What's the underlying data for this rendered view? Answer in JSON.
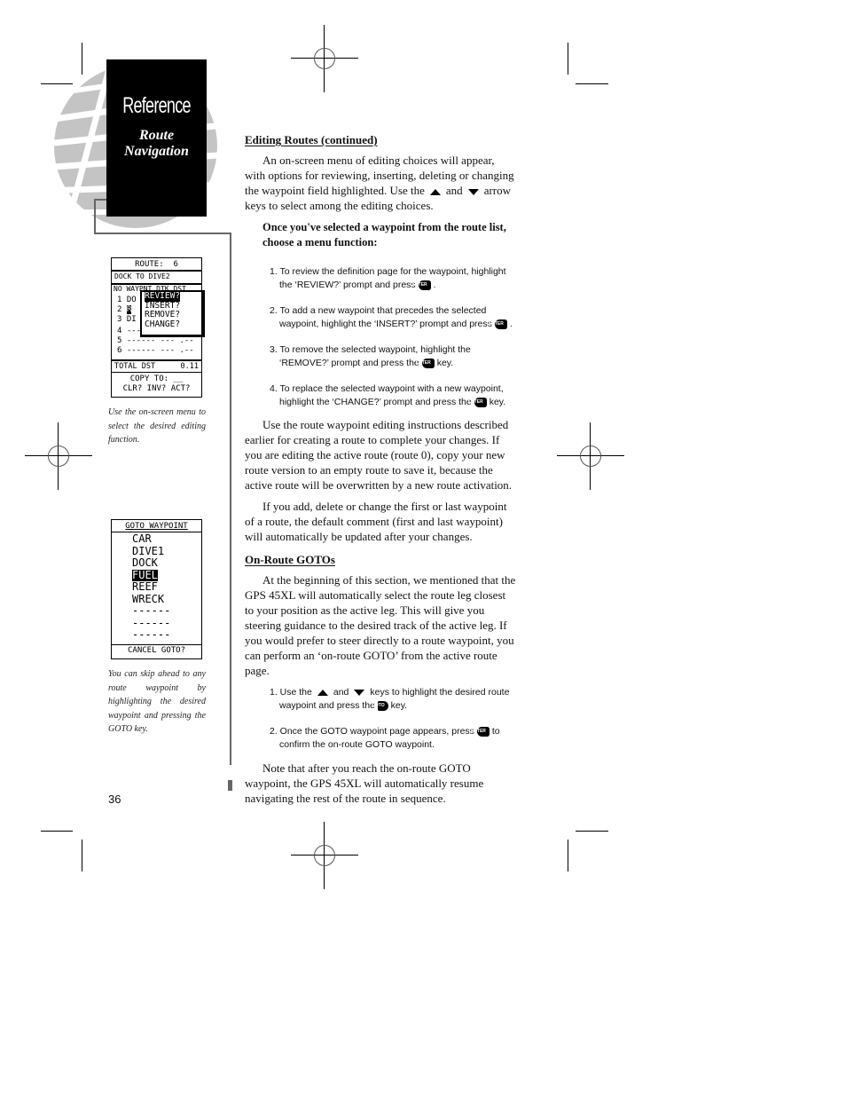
{
  "sidebar": {
    "section_title": "Reference",
    "section_subtitle_line1": "Route",
    "section_subtitle_line2": "Navigation"
  },
  "figure1": {
    "title": "ROUTE:  6",
    "comment": "DOCK TO DIVE2",
    "header": "NO WAYPNT DTK DST",
    "rows": [
      {
        "no": "1",
        "wpt": "DO"
      },
      {
        "no": "2",
        "wpt": "R"
      },
      {
        "no": "3",
        "wpt": "DI"
      },
      {
        "no": "4",
        "wpt": "------",
        "dtk": "",
        "dst": "."
      },
      {
        "no": "5",
        "wpt": "------",
        "dtk": "---",
        "dst": ".--"
      },
      {
        "no": "6",
        "wpt": "------",
        "dtk": "---",
        "dst": ".--"
      }
    ],
    "menu": [
      "REVIEW?",
      "INSERT?",
      "REMOVE?",
      "CHANGE?"
    ],
    "menu_selected": "REVIEW?",
    "total_label": "TOTAL DST",
    "total_value": "0.11",
    "copy_to": "COPY TO: __",
    "actions": "CLR? INV? ACT?",
    "caption": "Use the on-screen menu to select the desired editing function."
  },
  "figure2": {
    "title": "GOTO WAYPOINT",
    "waypoints": [
      "CAR",
      "DIVE1",
      "DOCK",
      "FUEL",
      "REEF",
      "WRECK",
      "------",
      "------",
      "------"
    ],
    "selected": "FUEL",
    "footer": "CANCEL GOTO?",
    "caption": "You can skip ahead to any route waypoint by highlighting the desired waypoint and pressing the GOTO key."
  },
  "content": {
    "heading1": "Editing Routes (continued)",
    "para1_a": "An on-screen menu of editing choices will appear, with options for reviewing, inserting, deleting or changing the waypoint field highlighted. Use the",
    "para1_b": "and",
    "para1_c": "arrow keys to select among the editing choices.",
    "bold_instruction": "Once you've selected a waypoint from the route list, choose a menu function:",
    "steps1": [
      {
        "before": "1. To review the definition page for the waypoint, highlight the ‘REVIEW?’ prompt and press",
        "key": "ENTER",
        "after": "."
      },
      {
        "before": "2. To add a new waypoint that precedes the selected waypoint, highlight the ‘INSERT?’ prompt and press",
        "key": "ENTER",
        "after": "."
      },
      {
        "before": "3. To remove the selected waypoint, highlight the ‘REMOVE?’ prompt and press the",
        "key": "ENTER",
        "after": "key."
      },
      {
        "before": "4. To replace the selected waypoint with a new waypoint, highlight the ‘CHANGE?’ prompt and press the",
        "key": "ENTER",
        "after": "key."
      }
    ],
    "para2": "Use the route waypoint editing instructions described earlier for creating a route to complete your changes. If you are editing the active route (route 0), copy your new route version to an empty route to save it, because the active route will be overwritten by a new route activation.",
    "para3": "If you add, delete or change the first or last waypoint of a route, the default comment (first and last waypoint) will automatically be updated after your changes.",
    "heading2": "On-Route GOTOs",
    "para4": "At the beginning of this section, we mentioned that the GPS 45XL will automatically select the route leg closest to your position as the active leg. This will give you steering guidance to the desired track of the active leg. If you would prefer to steer directly to a route waypoint, you can perform an ‘on-route GOTO’ from the active route page.",
    "steps2": {
      "s1_a": "1. Use the",
      "s1_b": "and",
      "s1_c": "keys to highlight the desired route waypoint and press the",
      "s1_key": "GOTO",
      "s1_d": "key.",
      "s2_a": "2. Once the GOTO waypoint page appears, press",
      "s2_key": "ENTER",
      "s2_b": "to confirm the on-route GOTO waypoint."
    },
    "para5": "Note that after you reach the on-route GOTO waypoint, the GPS 45XL will automatically resume navigating the rest of the route in sequence."
  },
  "footer": {
    "page_number": "36"
  }
}
